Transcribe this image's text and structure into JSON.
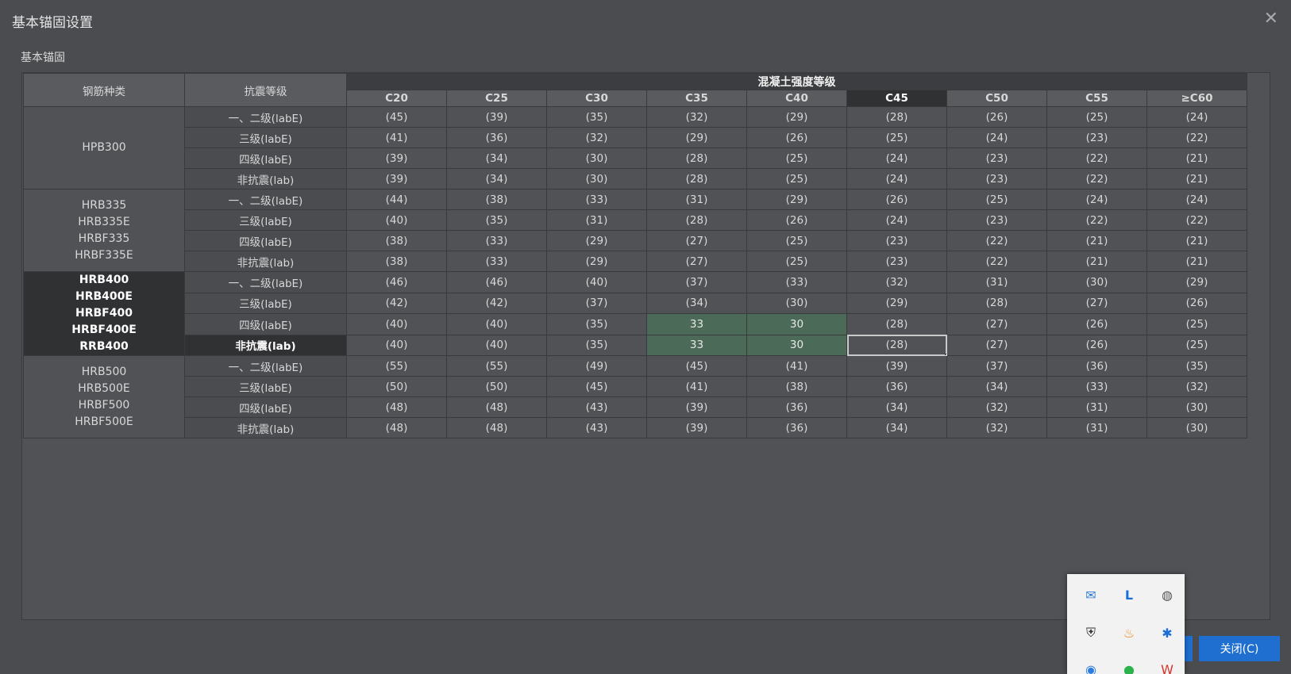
{
  "window": {
    "title": "基本锚固设置",
    "close_icon": "close-icon"
  },
  "section": {
    "label": "基本锚固"
  },
  "table": {
    "header": {
      "type_col": "钢筋种类",
      "level_col": "抗震等级",
      "group": "混凝土强度等级"
    },
    "grades": [
      "C20",
      "C25",
      "C30",
      "C35",
      "C40",
      "C45",
      "C50",
      "C55",
      "≥C60"
    ],
    "selected_grade_index": 5,
    "levels": [
      "一、二级(labE)",
      "三级(labE)",
      "四级(labE)",
      "非抗震(lab)"
    ],
    "rebar_groups": [
      {
        "types": [
          "HPB300"
        ],
        "rows": [
          [
            "(45)",
            "(39)",
            "(35)",
            "(32)",
            "(29)",
            "(28)",
            "(26)",
            "(25)",
            "(24)"
          ],
          [
            "(41)",
            "(36)",
            "(32)",
            "(29)",
            "(26)",
            "(25)",
            "(24)",
            "(23)",
            "(22)"
          ],
          [
            "(39)",
            "(34)",
            "(30)",
            "(28)",
            "(25)",
            "(24)",
            "(23)",
            "(22)",
            "(21)"
          ],
          [
            "(39)",
            "(34)",
            "(30)",
            "(28)",
            "(25)",
            "(24)",
            "(23)",
            "(22)",
            "(21)"
          ]
        ]
      },
      {
        "types": [
          "HRB335",
          "HRB335E",
          "HRBF335",
          "HRBF335E"
        ],
        "rows": [
          [
            "(44)",
            "(38)",
            "(33)",
            "(31)",
            "(29)",
            "(26)",
            "(25)",
            "(24)",
            "(24)"
          ],
          [
            "(40)",
            "(35)",
            "(31)",
            "(28)",
            "(26)",
            "(24)",
            "(23)",
            "(22)",
            "(22)"
          ],
          [
            "(38)",
            "(33)",
            "(29)",
            "(27)",
            "(25)",
            "(23)",
            "(22)",
            "(21)",
            "(21)"
          ],
          [
            "(38)",
            "(33)",
            "(29)",
            "(27)",
            "(25)",
            "(23)",
            "(22)",
            "(21)",
            "(21)"
          ]
        ]
      },
      {
        "types": [
          "HRB400",
          "HRB400E",
          "HRBF400",
          "HRBF400E",
          "RRB400"
        ],
        "selected": true,
        "rows": [
          [
            "(46)",
            "(46)",
            "(40)",
            "(37)",
            "(33)",
            "(32)",
            "(31)",
            "(30)",
            "(29)"
          ],
          [
            "(42)",
            "(42)",
            "(37)",
            "(34)",
            "(30)",
            "(29)",
            "(28)",
            "(27)",
            "(26)"
          ],
          [
            "(40)",
            "(40)",
            "(35)",
            "33",
            "30",
            "(28)",
            "(27)",
            "(26)",
            "(25)"
          ],
          [
            "(40)",
            "(40)",
            "(35)",
            "33",
            "30",
            "(28)",
            "(27)",
            "(26)",
            "(25)"
          ]
        ]
      },
      {
        "types": [
          "HRB500",
          "HRB500E",
          "HRBF500",
          "HRBF500E"
        ],
        "rows": [
          [
            "(55)",
            "(55)",
            "(49)",
            "(45)",
            "(41)",
            "(39)",
            "(37)",
            "(36)",
            "(35)"
          ],
          [
            "(50)",
            "(50)",
            "(45)",
            "(41)",
            "(38)",
            "(36)",
            "(34)",
            "(33)",
            "(32)"
          ],
          [
            "(48)",
            "(48)",
            "(43)",
            "(39)",
            "(36)",
            "(34)",
            "(32)",
            "(31)",
            "(30)"
          ],
          [
            "(48)",
            "(48)",
            "(43)",
            "(39)",
            "(36)",
            "(34)",
            "(32)",
            "(31)",
            "(30)"
          ]
        ]
      }
    ]
  },
  "footer": {
    "close_button": "关闭(C)"
  },
  "tray": {
    "icons": [
      "wechat-work-icon",
      "lenovo-icon",
      "globe-icon",
      "security-shield-icon",
      "fire-icon",
      "bluetooth-icon",
      "chrome-icon",
      "wechat-icon",
      "wps-icon"
    ]
  },
  "colors": {
    "accent": "#1f6fd1",
    "edited_cell": "#4b6b58",
    "selected_header": "#303133"
  }
}
